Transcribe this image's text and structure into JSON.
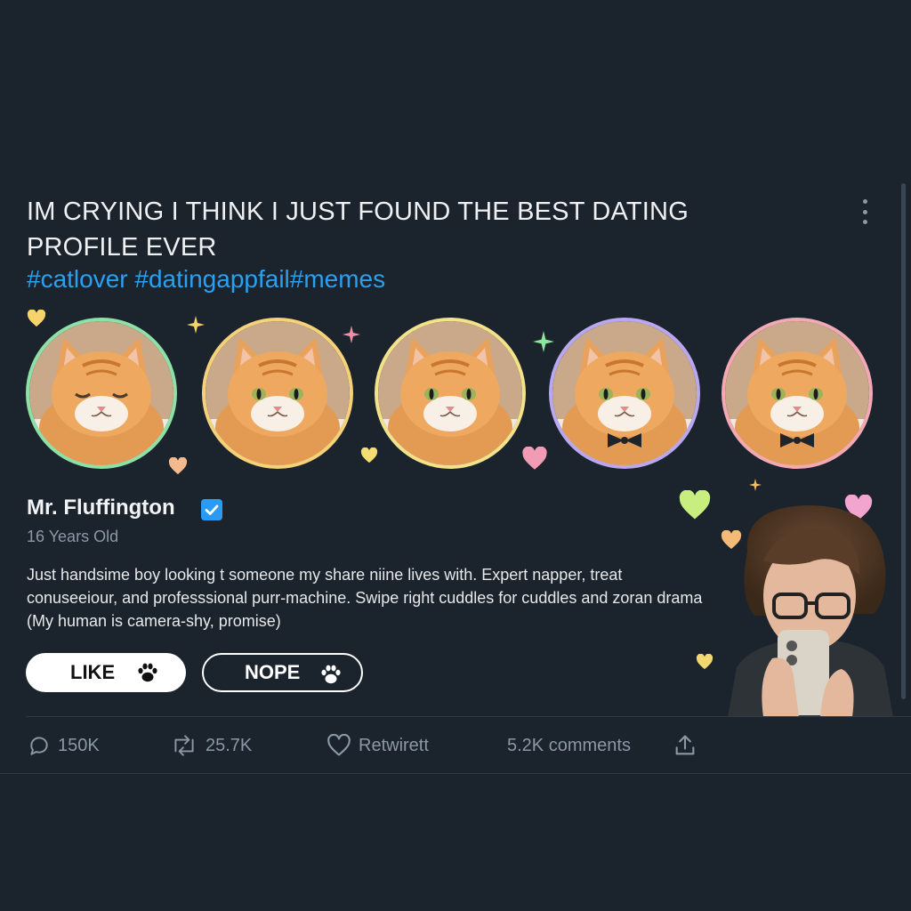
{
  "post": {
    "title_line1": "IM CRYING I THINK I JUST FOUND THE BEST DATING",
    "title_line2": "PROFILE EVER",
    "hashtags": "#catlover #datingappfail#memes"
  },
  "profile": {
    "name": "Mr. Fluffington",
    "verified": true,
    "age": "16 Years Old",
    "bio_lines": [
      "Just handsime boy looking t someone my share niine lives with. Expert napper, treat",
      "conuseeiour, and professsional purr-machine. Swipe right cuddles for cuddles and zoran drama",
      "(My human is camera-shy, promise)"
    ],
    "photos": [
      {
        "name": "cat-photo-1",
        "ring_color": "#8de0a6"
      },
      {
        "name": "cat-photo-2",
        "ring_color": "#f5d27a"
      },
      {
        "name": "cat-photo-3",
        "ring_color": "#f2e38a"
      },
      {
        "name": "cat-photo-4",
        "ring_color": "#b9a8f0"
      },
      {
        "name": "cat-photo-5",
        "ring_color": "#f3a9b4"
      }
    ]
  },
  "buttons": {
    "like_label": "LIKE",
    "nope_label": "NOPE",
    "icon": "paw-icon"
  },
  "actions": {
    "replies": "150K",
    "reposts": "25.7K",
    "likes_label": "Retwirett",
    "comments": "5.2K comments"
  },
  "colors": {
    "background": "#1b232d",
    "hashtag": "#2aa0f0",
    "verified": "#2b9af3",
    "muted": "#8b98a5"
  }
}
